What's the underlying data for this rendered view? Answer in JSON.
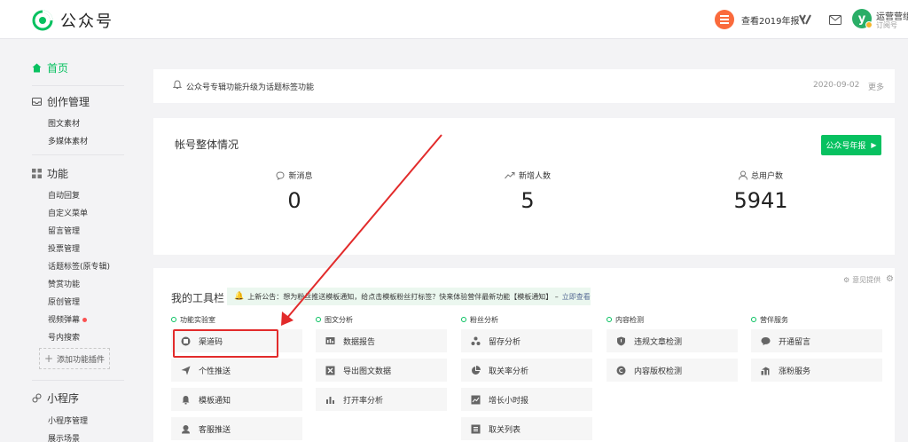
{
  "header": {
    "app_name": "公众号",
    "report_link": "查看2019年报",
    "account_name": "运营营组",
    "account_type": "订阅号"
  },
  "sidebar": {
    "home": "首页",
    "sections": [
      {
        "title": "创作管理",
        "items": [
          "图文素材",
          "多媒体素材"
        ]
      },
      {
        "title": "功能",
        "items": [
          "自动回复",
          "自定义菜单",
          "留言管理",
          "投票管理",
          "话题标签(原专辑)",
          "赞赏功能",
          "原创管理",
          "视频弹幕",
          "号内搜索"
        ]
      },
      {
        "title": "小程序",
        "items": [
          "小程序管理",
          "展示场景"
        ]
      }
    ],
    "add_plugin": "添加功能插件"
  },
  "notice": {
    "text": "公众号专辑功能升级为话题标签功能",
    "date": "2020-09-02",
    "more": "更多"
  },
  "overview": {
    "title": "帐号整体情况",
    "annual_button": "公众号年报",
    "stats": [
      {
        "label": "新消息",
        "value": "0",
        "icon": "chat-bubble-icon"
      },
      {
        "label": "新增人数",
        "value": "5",
        "icon": "trend-up-icon"
      },
      {
        "label": "总用户数",
        "value": "5941",
        "icon": "user-icon"
      }
    ]
  },
  "toolbar": {
    "title": "我的工具栏",
    "feedback": "意见提供",
    "announcement": "上新公告：想为粉丝推送模板通知，给点击模板粉丝打标签？快来体验营伴最新功能【模板通知】 –",
    "announcement_link": "立即查看",
    "columns": [
      {
        "heading": "功能实验室",
        "tools": [
          "渠道码",
          "个性推送",
          "模板通知",
          "客服推送"
        ]
      },
      {
        "heading": "图文分析",
        "tools": [
          "数据报告",
          "导出图文数据",
          "打开率分析"
        ]
      },
      {
        "heading": "粉丝分析",
        "tools": [
          "留存分析",
          "取关率分析",
          "增长小时报",
          "取关列表"
        ]
      },
      {
        "heading": "内容检测",
        "tools": [
          "违规文章检测",
          "内容版权检测"
        ]
      },
      {
        "heading": "营伴服务",
        "tools": [
          "开通留言",
          "涨粉服务"
        ]
      }
    ]
  },
  "colors": {
    "accent": "#07c160",
    "highlight": "#e22b2b",
    "link": "#576b95"
  }
}
